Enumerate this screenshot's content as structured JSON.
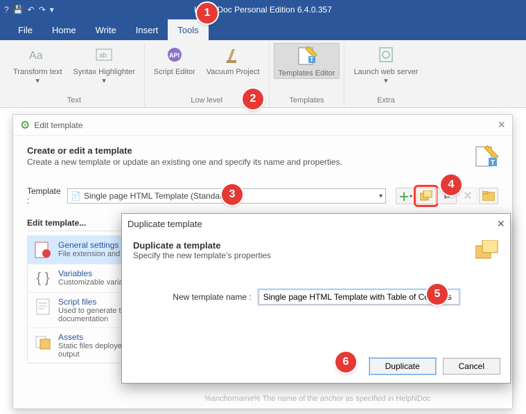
{
  "app_title": "HelpNDoc Personal Edition 6.4.0.357",
  "tabs": [
    "File",
    "Home",
    "Write",
    "Insert",
    "Tools"
  ],
  "active_tab": "Tools",
  "ribbon": {
    "groups": [
      {
        "label": "Text",
        "buttons": [
          {
            "label": "Transform text ",
            "glyph": "Aa",
            "arrow": true
          },
          {
            "label": "Syntax Highlighter ",
            "glyph": "HL",
            "arrow": true
          }
        ]
      },
      {
        "label": "Low level",
        "buttons": [
          {
            "label": "Script Editor",
            "glyph": "API"
          },
          {
            "label": "Vacuum Project",
            "glyph": "🧹"
          }
        ]
      },
      {
        "label": "Templates",
        "buttons": [
          {
            "label": "Templates Editor",
            "glyph": "📝",
            "active": true
          }
        ]
      },
      {
        "label": "Extra",
        "buttons": [
          {
            "label": "Launch web server ",
            "glyph": "🖥",
            "arrow": true
          }
        ]
      }
    ]
  },
  "dialog1": {
    "title": "Edit template",
    "heading": "Create or edit a template",
    "sub": "Create a new template or update an existing one and specify its name and properties.",
    "template_label": "Template :",
    "selected_template": "Single page HTML Template (Standard)",
    "edit_label": "Edit template...",
    "side_items": [
      {
        "title": "General settings",
        "sub": "File extension and in…",
        "sel": true,
        "icon": "settings"
      },
      {
        "title": "Variables",
        "sub": "Customizable variable settings",
        "icon": "braces"
      },
      {
        "title": "Script files",
        "sub": "Used to generate the documentation",
        "icon": "script"
      },
      {
        "title": "Assets",
        "sub": "Static files deployed generated output",
        "icon": "assets"
      }
    ]
  },
  "dialog2": {
    "window_title": "Duplicate template",
    "heading": "Duplicate a template",
    "sub": "Specify the new template's properties",
    "name_label": "New template name :",
    "name_value": "Single page HTML Template with Table of Contents",
    "ok": "Duplicate",
    "cancel": "Cancel"
  },
  "ghost_text": "%anchorname%  The name of the anchor as specified in HelpNDoc",
  "badges": {
    "1": "1",
    "2": "2",
    "3": "3",
    "4": "4",
    "5": "5",
    "6": "6"
  }
}
